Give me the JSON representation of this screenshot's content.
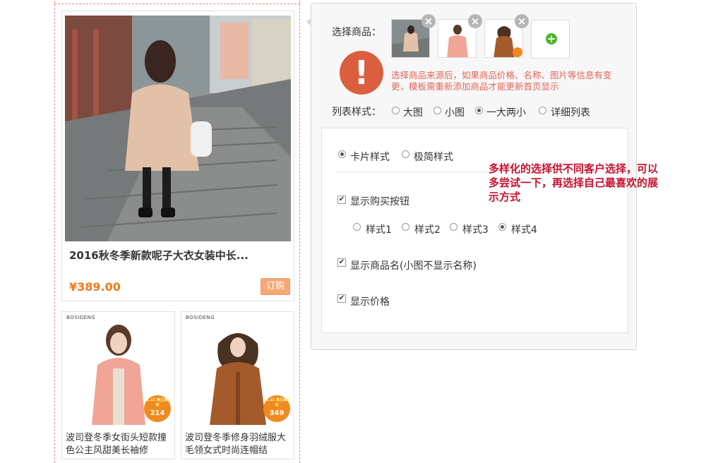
{
  "preview": {
    "featured": {
      "title": "2016秋冬季新款呢子大衣女装中长...",
      "price": "¥389.00",
      "buy_label": "订购"
    },
    "small_items": [
      {
        "brand": "BOSIDENG",
        "badge_top": "12.12 满立减活动",
        "badge_price": "214",
        "name": "波司登冬季女街头短款撞色公主风甜美长袖修"
      },
      {
        "brand": "BOSIDENG",
        "badge_top": "12.12 满立减活动",
        "badge_price": "349",
        "name": "波司登冬季修身羽绒服大毛领女式时尚连帽结"
      }
    ]
  },
  "settings": {
    "select_products_label": "选择商品：",
    "warning": "选择商品来源后，如果商品价格、名称、图片等信息有变更，模板需重新添加商品才能更新首页显示",
    "list_style_label": "列表样式：",
    "list_styles": [
      "大图",
      "小图",
      "一大两小",
      "详细列表"
    ],
    "card_styles": [
      "卡片样式",
      "极简样式"
    ],
    "show_buy_button": "显示购买按钮",
    "buy_styles": [
      "样式1",
      "样式2",
      "样式3",
      "样式4"
    ],
    "show_name": "显示商品名(小图不显示名称)",
    "show_price": "显示价格"
  },
  "annotation": "多样化的选择供不同客户选择，可以多尝试一下，再选择自己最喜欢的展示方式",
  "colors": {
    "accent_price": "#f07a1a",
    "warning": "#e0665a",
    "note": "#c8102e",
    "add": "#48b82a"
  }
}
